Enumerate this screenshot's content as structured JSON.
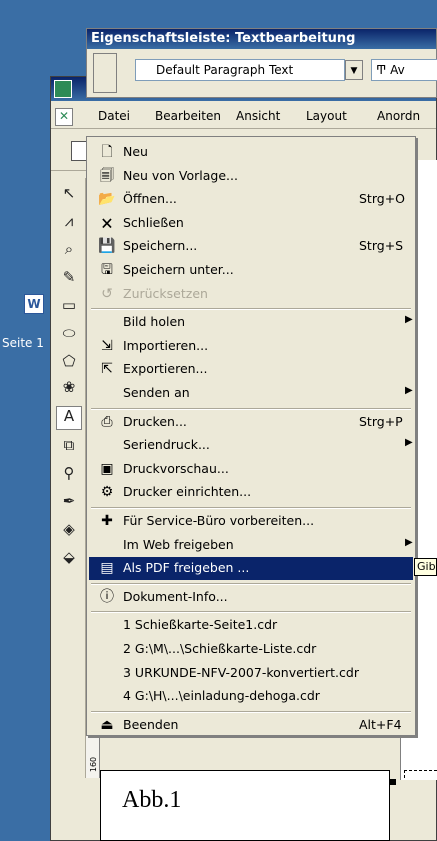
{
  "propbar": {
    "title": "Eigenschaftsleiste: Textbearbeitung",
    "style_value": "Default Paragraph Text",
    "font_value": "Av"
  },
  "desktop": {
    "label": "Seite 1"
  },
  "menubar": {
    "items": [
      "Datei",
      "Bearbeiten",
      "Ansicht",
      "Layout",
      "Anordn"
    ]
  },
  "filemenu": {
    "items": [
      {
        "label": "Neu",
        "shortcut": "",
        "icon": "new-document-icon"
      },
      {
        "label": "Neu von Vorlage...",
        "shortcut": "",
        "icon": "template-icon"
      },
      {
        "label": "Öffnen...",
        "shortcut": "Strg+O",
        "icon": "open-folder-icon"
      },
      {
        "label": "Schließen",
        "shortcut": "",
        "icon": "close-document-icon"
      },
      {
        "label": "Speichern...",
        "shortcut": "Strg+S",
        "icon": "save-icon"
      },
      {
        "label": "Speichern unter...",
        "shortcut": "",
        "icon": "save-as-icon"
      },
      {
        "label": "Zurücksetzen",
        "shortcut": "",
        "icon": "revert-icon",
        "disabled": true
      },
      {
        "label": "Bild holen",
        "shortcut": "",
        "submenu": true
      },
      {
        "label": "Importieren...",
        "shortcut": "",
        "icon": "import-icon"
      },
      {
        "label": "Exportieren...",
        "shortcut": "",
        "icon": "export-icon"
      },
      {
        "label": "Senden an",
        "shortcut": "",
        "submenu": true
      },
      {
        "label": "Drucken...",
        "shortcut": "Strg+P",
        "icon": "print-icon"
      },
      {
        "label": "Seriendruck...",
        "shortcut": "",
        "submenu": true
      },
      {
        "label": "Druckvorschau...",
        "shortcut": "",
        "icon": "print-preview-icon"
      },
      {
        "label": "Drucker einrichten...",
        "shortcut": "",
        "icon": "printer-setup-icon"
      },
      {
        "label": "Für Service-Büro vorbereiten...",
        "shortcut": "",
        "icon": "service-bureau-icon"
      },
      {
        "label": "Im Web freigeben",
        "shortcut": "",
        "submenu": true
      },
      {
        "label": "Als PDF freigeben ...",
        "shortcut": "",
        "icon": "pdf-icon",
        "selected": true
      },
      {
        "label": "Dokument-Info...",
        "shortcut": "",
        "icon": "info-icon"
      },
      {
        "label": "1 Schießkarte-Seite1.cdr",
        "shortcut": ""
      },
      {
        "label": "2 G:\\M\\...\\Schießkarte-Liste.cdr",
        "shortcut": ""
      },
      {
        "label": "3 URKUNDE-NFV-2007-konvertiert.cdr",
        "shortcut": ""
      },
      {
        "label": "4 G:\\H\\...\\einladung-dehoga.cdr",
        "shortcut": ""
      },
      {
        "label": "Beenden",
        "shortcut": "Alt+F4",
        "icon": "exit-icon"
      }
    ]
  },
  "tooltip": {
    "text": "Gib"
  },
  "caption": {
    "text": "Abb.1"
  },
  "ruler": {
    "mark": "160"
  }
}
